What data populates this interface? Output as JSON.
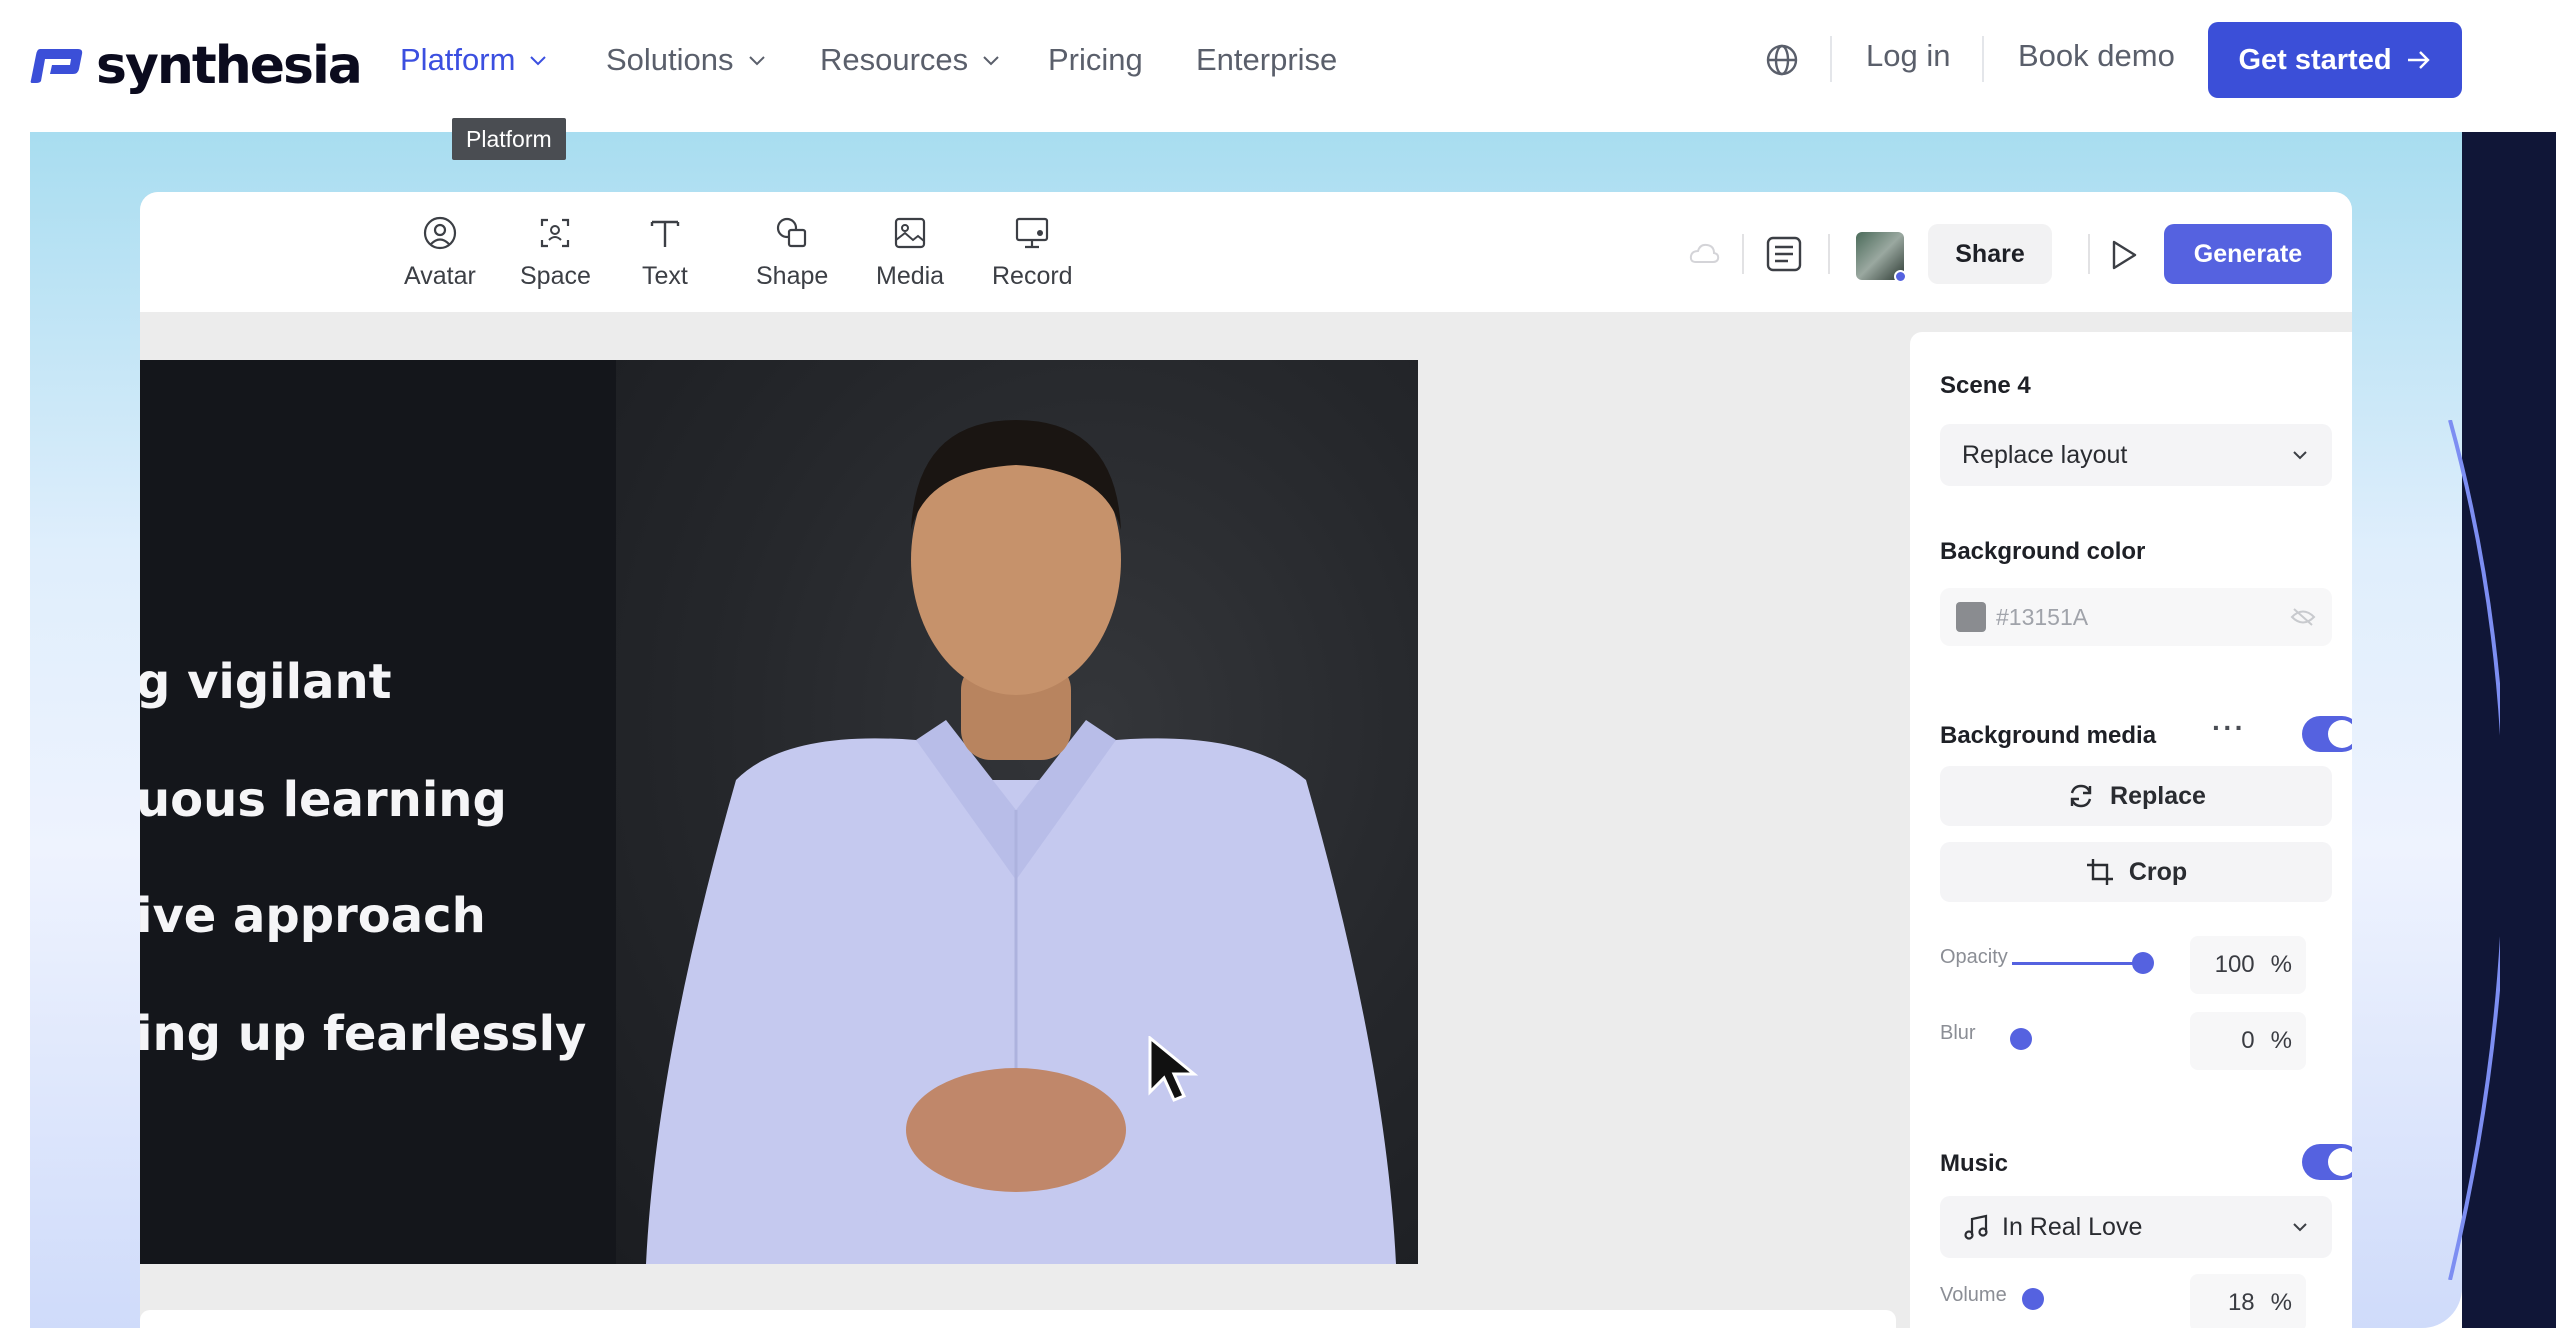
{
  "nav": {
    "logo_text": "synthesia",
    "items": [
      {
        "label": "Platform",
        "active": true,
        "has_dropdown": true
      },
      {
        "label": "Solutions",
        "active": false,
        "has_dropdown": true
      },
      {
        "label": "Resources",
        "active": false,
        "has_dropdown": true
      },
      {
        "label": "Pricing",
        "active": false,
        "has_dropdown": false
      },
      {
        "label": "Enterprise",
        "active": false,
        "has_dropdown": false
      }
    ],
    "tooltip": "Platform",
    "login": "Log in",
    "book_demo": "Book demo",
    "get_started": "Get started",
    "accent_color": "#3b4fd8"
  },
  "editor": {
    "tools": [
      {
        "label": "Avatar",
        "icon": "avatar-icon"
      },
      {
        "label": "Space",
        "icon": "space-icon"
      },
      {
        "label": "Text",
        "icon": "text-icon"
      },
      {
        "label": "Shape",
        "icon": "shape-icon"
      },
      {
        "label": "Media",
        "icon": "media-icon"
      },
      {
        "label": "Record",
        "icon": "record-icon"
      }
    ],
    "share": "Share",
    "generate": "Generate",
    "canvas_lines": [
      "g vigilant",
      "uous learning",
      "ive approach",
      "ing up fearlessly"
    ]
  },
  "panel": {
    "scene_title": "Scene 4",
    "layout_select": "Replace layout",
    "bg_color_label": "Background color",
    "bg_color_value": "#13151A",
    "bg_media_label": "Background media",
    "bg_media_enabled": true,
    "replace_btn": "Replace",
    "crop_btn": "Crop",
    "opacity_label": "Opacity",
    "opacity_value": "100",
    "blur_label": "Blur",
    "blur_value": "0",
    "percent": "%",
    "music_label": "Music",
    "music_enabled": true,
    "music_track": "In Real Love",
    "volume_label": "Volume",
    "volume_value": "18"
  }
}
